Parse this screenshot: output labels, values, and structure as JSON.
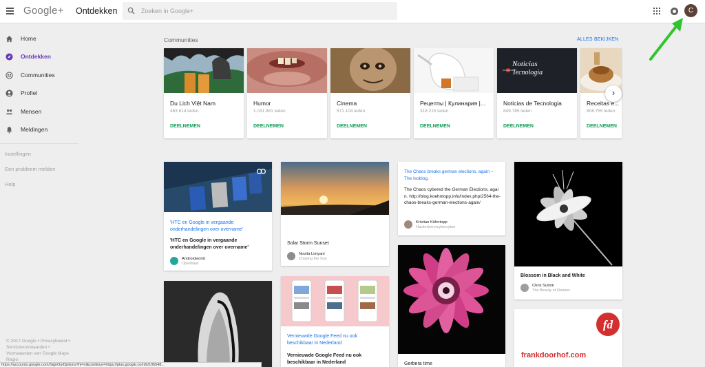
{
  "topbar": {
    "logo": "Google+",
    "section_title": "Ontdekken",
    "search_placeholder": "Zoeken in Google+",
    "avatar_letter": "C"
  },
  "sidebar": {
    "items": [
      {
        "label": "Home",
        "icon": "home-icon"
      },
      {
        "label": "Ontdekken",
        "icon": "compass-icon",
        "active": true
      },
      {
        "label": "Communities",
        "icon": "communities-icon"
      },
      {
        "label": "Profiel",
        "icon": "profile-icon"
      },
      {
        "label": "Mensen",
        "icon": "people-icon"
      },
      {
        "label": "Meldingen",
        "icon": "bell-icon"
      }
    ],
    "links": [
      "Instellingen",
      "Een probleem melden",
      "Help"
    ],
    "footer": {
      "copyright": "© 2017 Google",
      "privacy": "Privacybeleid",
      "terms": "Servicevoorwaarden",
      "maps": "Voorwaarden van Google Maps",
      "region": "Regio"
    }
  },
  "communities": {
    "header": "Communities",
    "see_all": "ALLES BEKIJKEN",
    "join_label": "DEELNEMEN",
    "items": [
      {
        "name": "Du Lich Việt Nam",
        "members": "463.814 leden"
      },
      {
        "name": "Humor",
        "members": "1.031.881 leden"
      },
      {
        "name": "Cinema",
        "members": "571.104 leden"
      },
      {
        "name": "Рецепты | Кулинария |...",
        "members": "318.215 leden"
      },
      {
        "name": "Noticias de Tecnologia",
        "members": "849.785 leden"
      },
      {
        "name": "Receitas e...",
        "members": "808.755 leden"
      }
    ],
    "noticias_logo": "Noticias Tecnologia"
  },
  "posts": {
    "htc": {
      "link_title": "'HTC en Google in vergaande onderhandelingen over overname'",
      "text": "'HTC en Google in vergaande onderhandelingen over overname'",
      "author": "Androidworld",
      "sub": "Openbaar"
    },
    "solar": {
      "title": "Solar Storm Sunset",
      "author": "Novita Listyani",
      "sub": "Chasing the Sun"
    },
    "chaos": {
      "link_title": "The Chaos breaks german elections, again – The Isoblog.",
      "text": "The Chaos cybered the German Elections, again. http://blog.koehntopp.info/index.php/2564-the-chaos-breaks-german-elections-again/",
      "author": "Kristian Köhntopp",
      "sub": "Hackerterrorcybercyber"
    },
    "blossom": {
      "title": "Blossom in Black and White",
      "author": "Chris Sutton",
      "sub": "The Beauty of Flowers"
    },
    "feed": {
      "link_title": "Vernieuwde Google Feed nu ook beschikbaar in Nederland",
      "text": "Vernieuwde Google Feed nu ook beschikbaar in Nederland"
    },
    "gerbera": {
      "title": "Gerbera time"
    },
    "frank": {
      "site": "frankdoorhof.com",
      "logo": "fd"
    }
  },
  "statusbar": "https://accounts.google.com/SignOutOptions?hl=nl&continue=https://plus.google.com/b/106548..."
}
